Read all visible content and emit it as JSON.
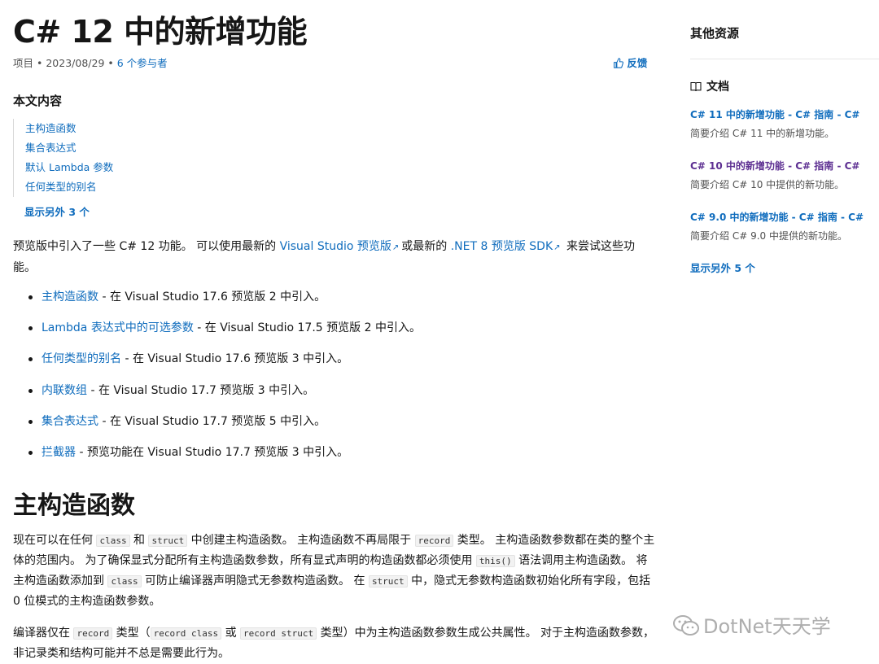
{
  "page": {
    "title_prefix": "C# 12",
    "title_suffix": "中的新增功能",
    "meta": {
      "type": "项目",
      "sep1": "•",
      "date": "2023/08/29",
      "sep2": "•",
      "contributors": "6 个参与者"
    },
    "feedback_label": "反馈"
  },
  "toc": {
    "title": "本文内容",
    "items": [
      {
        "label": "主构造函数"
      },
      {
        "label": "集合表达式"
      },
      {
        "label": "默认 Lambda 参数"
      },
      {
        "label": "任何类型的别名"
      }
    ],
    "more_label": "显示另外 3 个"
  },
  "intro": {
    "t1": "预览版中引入了一些 C# 12 功能。 可以使用最新的 ",
    "link1": "Visual Studio 预览版",
    "t2": "或最新的 ",
    "link2": ".NET 8 预览版 SDK",
    "t3": " 来尝试这些功能。",
    "ext_icon": "external-link-icon"
  },
  "features": [
    {
      "link": "主构造函数",
      "desc": " - 在 Visual Studio 17.6 预览版 2 中引入。"
    },
    {
      "link": "Lambda 表达式中的可选参数",
      "desc": " - 在 Visual Studio 17.5 预览版 2 中引入。"
    },
    {
      "link": "任何类型的别名",
      "desc": " - 在 Visual Studio 17.6 预览版 3 中引入。"
    },
    {
      "link": "内联数组",
      "desc": " - 在 Visual Studio 17.7 预览版 3 中引入。"
    },
    {
      "link": "集合表达式",
      "desc": " - 在 Visual Studio 17.7 预览版 5 中引入。"
    },
    {
      "link": "拦截器",
      "desc": " - 预览功能在 Visual Studio 17.7 预览版 3 中引入。"
    }
  ],
  "section1": {
    "heading": "主构造函数",
    "p1": {
      "a": "现在可以在任何 ",
      "c1": "class",
      "b": " 和 ",
      "c2": "struct",
      "c": " 中创建主构造函数。 主构造函数不再局限于 ",
      "c3": "record",
      "d": " 类型。 主构造函数参数都在类的整个主体的范围内。 为了确保显式分配所有主构造函数参数，所有显式声明的构造函数都必须使用 ",
      "c4": "this()",
      "e": " 语法调用主构造函数。 将主构造函数添加到 ",
      "c5": "class",
      "f": " 可防止编译器声明隐式无参数构造函数。 在 ",
      "c6": "struct",
      "g": " 中，隐式无参数构造函数初始化所有字段，包括 0 位模式的主构造函数参数。"
    },
    "p2": {
      "a": "编译器仅在 ",
      "c1": "record",
      "b": " 类型（",
      "c2": "record class",
      "c": " 或 ",
      "c3": "record struct",
      "d": " 类型）中为主构造函数参数生成公共属性。 对于主构造函数参数，非记录类和结构可能并不总是需要此行为。"
    }
  },
  "sidebar": {
    "title": "其他资源",
    "docs_label": "文档",
    "docs_icon": "book-icon",
    "items": [
      {
        "title": "C# 11 中的新增功能 - C# 指南 - C#",
        "desc": "简要介绍 C# 11 中的新增功能。"
      },
      {
        "title": "C# 10 中的新增功能 - C# 指南 - C#",
        "desc": "简要介绍 C# 10 中提供的新功能。"
      },
      {
        "title": "C# 9.0 中的新增功能 - C# 指南 - C#",
        "desc": "简要介绍 C# 9.0 中提供的新功能。"
      }
    ],
    "more_label": "显示另外 5 个"
  },
  "watermark": {
    "text": "DotNet天天学",
    "icon": "wechat-icon"
  },
  "colors": {
    "link": "#0f6cbd",
    "visited": "#5c2e91",
    "text": "#161616",
    "muted": "#505050"
  }
}
